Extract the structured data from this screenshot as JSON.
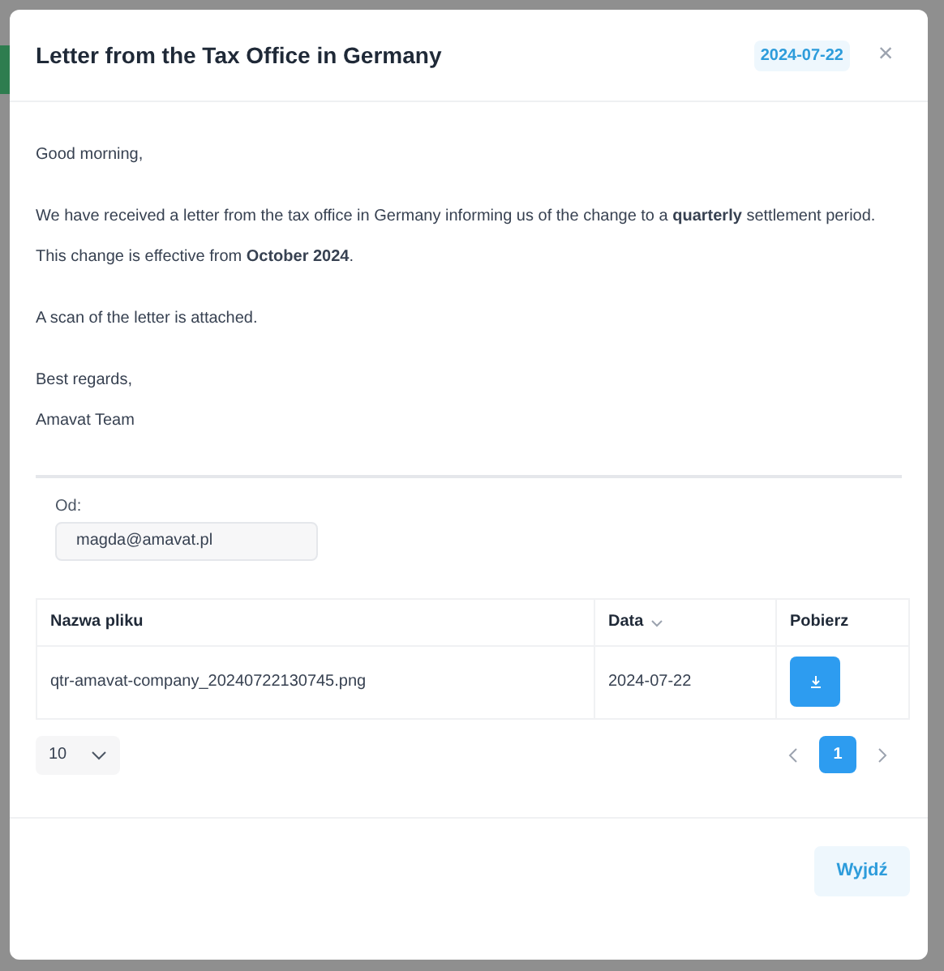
{
  "dialog": {
    "title": "Letter from the Tax Office in Germany",
    "date_badge": "2024-07-22",
    "close_label": "×"
  },
  "message": [
    [
      "Good morning,"
    ],
    [
      "We have received a letter from the tax office in Germany informing us of the change to a **quarterly** settlement period.",
      "This change is effective from **October 2024**."
    ],
    [
      "A scan of the letter is attached."
    ],
    [
      "Best regards,",
      "Amavat Team"
    ]
  ],
  "sender": {
    "label": "Od:",
    "value": "magda@amavat.pl"
  },
  "table": {
    "columns": [
      {
        "label": "Nazwa pliku",
        "sortable": false
      },
      {
        "label": "Data",
        "sortable": true
      },
      {
        "label": "Pobierz",
        "sortable": false
      }
    ],
    "rows": [
      {
        "file_name": "qtr-amavat-company_20240722130745.png",
        "date": "2024-07-22"
      }
    ]
  },
  "pagination": {
    "page_size": "10",
    "pages": [
      {
        "label": "1",
        "selected": true
      }
    ]
  },
  "footer": {
    "exit_button": "Wyjdź"
  }
}
